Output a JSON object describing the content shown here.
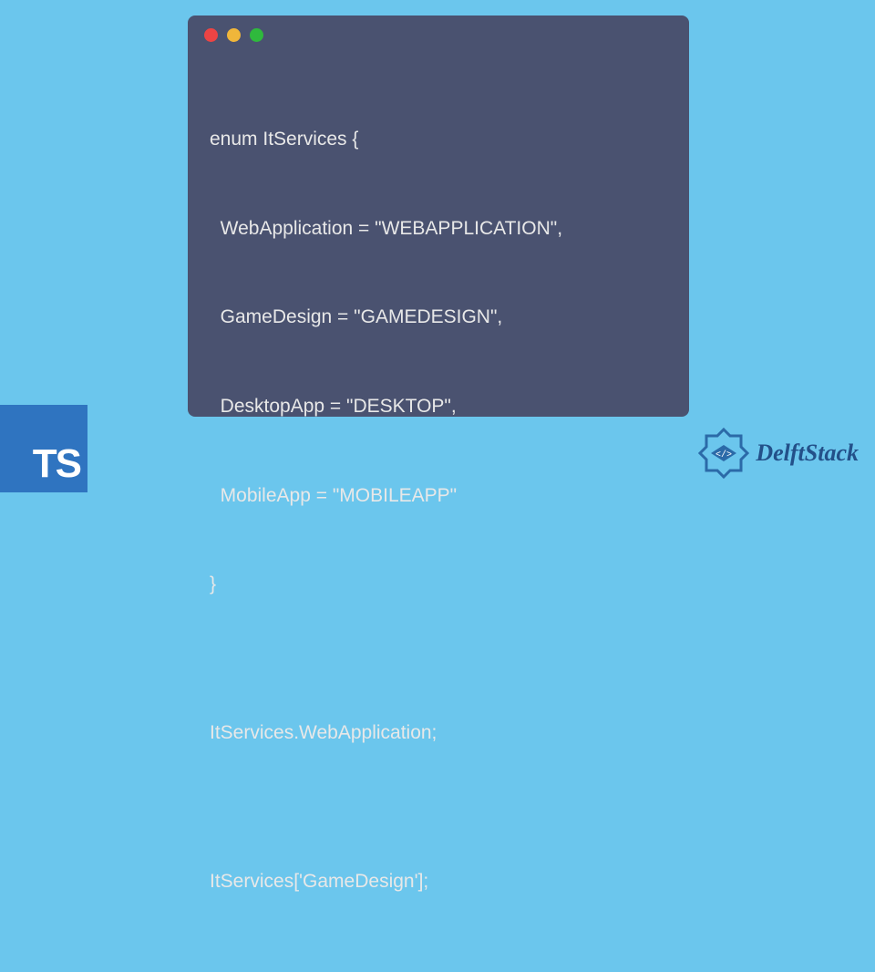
{
  "code": {
    "lines": [
      "enum ItServices {",
      "  WebApplication = \"WEBAPPLICATION\",",
      "  GameDesign = \"GAMEDESIGN\",",
      "  DesktopApp = \"DESKTOP\",",
      "  MobileApp = \"MOBILEAPP\"",
      "}",
      "",
      "ItServices.WebApplication;",
      "",
      "ItServices['GameDesign'];"
    ]
  },
  "ts_badge": {
    "text": "TS"
  },
  "brand": {
    "name": "DelftStack"
  },
  "colors": {
    "background": "#6bc6ed",
    "window": "#4a5270",
    "code_text": "#e8e8e8",
    "ts_badge": "#2f74c0",
    "brand_text": "#235089",
    "brand_icon": "#2b6aa8"
  }
}
